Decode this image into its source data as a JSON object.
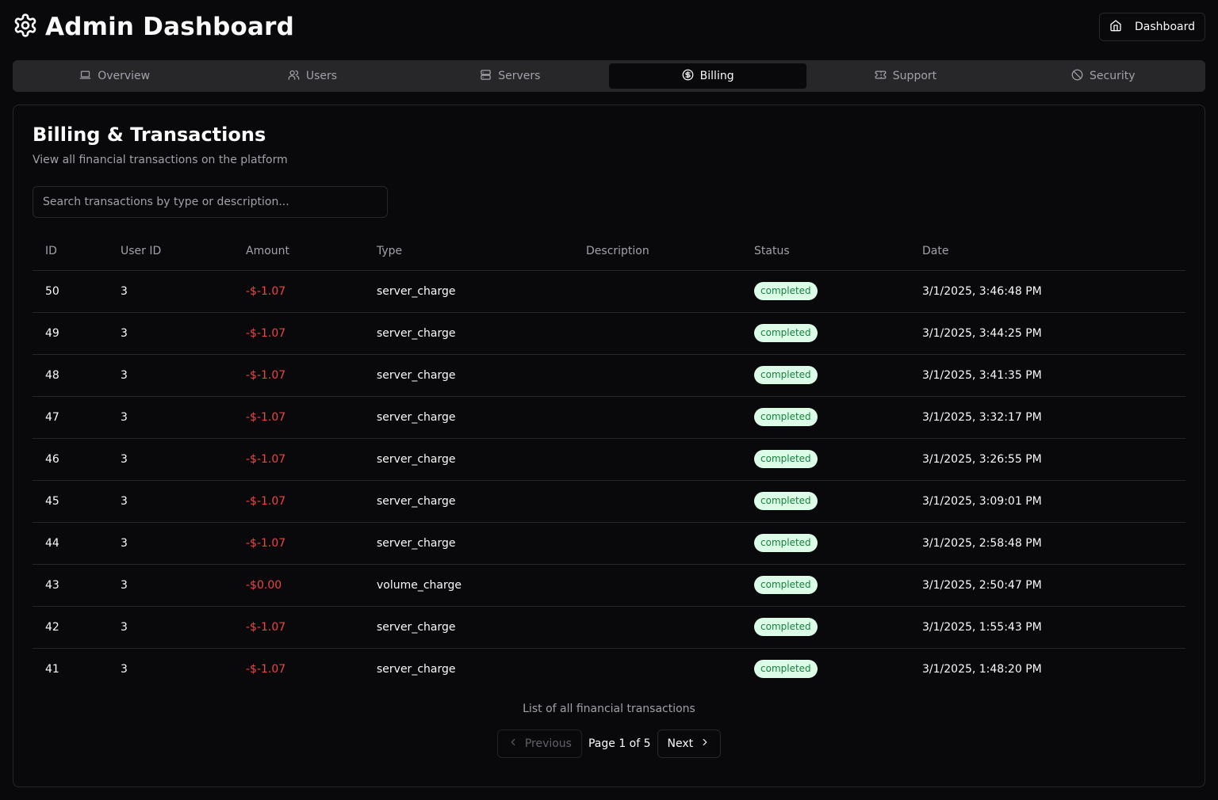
{
  "header": {
    "title": "Admin Dashboard",
    "dashboard_button": "Dashboard"
  },
  "tabs": [
    {
      "label": "Overview",
      "icon": "laptop-icon"
    },
    {
      "label": "Users",
      "icon": "users-icon"
    },
    {
      "label": "Servers",
      "icon": "server-icon"
    },
    {
      "label": "Billing",
      "icon": "dollar-circle-icon",
      "active": true
    },
    {
      "label": "Support",
      "icon": "ticket-icon"
    },
    {
      "label": "Security",
      "icon": "ban-icon"
    }
  ],
  "billing": {
    "title": "Billing & Transactions",
    "description": "View all financial transactions on the platform",
    "search_placeholder": "Search transactions by type or description...",
    "columns": [
      "ID",
      "User ID",
      "Amount",
      "Type",
      "Description",
      "Status",
      "Date"
    ],
    "rows": [
      {
        "id": "50",
        "user_id": "3",
        "amount": "-$-1.07",
        "type": "server_charge",
        "description": "",
        "status": "completed",
        "date": "3/1/2025, 3:46:48 PM"
      },
      {
        "id": "49",
        "user_id": "3",
        "amount": "-$-1.07",
        "type": "server_charge",
        "description": "",
        "status": "completed",
        "date": "3/1/2025, 3:44:25 PM"
      },
      {
        "id": "48",
        "user_id": "3",
        "amount": "-$-1.07",
        "type": "server_charge",
        "description": "",
        "status": "completed",
        "date": "3/1/2025, 3:41:35 PM"
      },
      {
        "id": "47",
        "user_id": "3",
        "amount": "-$-1.07",
        "type": "server_charge",
        "description": "",
        "status": "completed",
        "date": "3/1/2025, 3:32:17 PM"
      },
      {
        "id": "46",
        "user_id": "3",
        "amount": "-$-1.07",
        "type": "server_charge",
        "description": "",
        "status": "completed",
        "date": "3/1/2025, 3:26:55 PM"
      },
      {
        "id": "45",
        "user_id": "3",
        "amount": "-$-1.07",
        "type": "server_charge",
        "description": "",
        "status": "completed",
        "date": "3/1/2025, 3:09:01 PM"
      },
      {
        "id": "44",
        "user_id": "3",
        "amount": "-$-1.07",
        "type": "server_charge",
        "description": "",
        "status": "completed",
        "date": "3/1/2025, 2:58:48 PM"
      },
      {
        "id": "43",
        "user_id": "3",
        "amount": "-$0.00",
        "type": "volume_charge",
        "description": "",
        "status": "completed",
        "date": "3/1/2025, 2:50:47 PM"
      },
      {
        "id": "42",
        "user_id": "3",
        "amount": "-$-1.07",
        "type": "server_charge",
        "description": "",
        "status": "completed",
        "date": "3/1/2025, 1:55:43 PM"
      },
      {
        "id": "41",
        "user_id": "3",
        "amount": "-$-1.07",
        "type": "server_charge",
        "description": "",
        "status": "completed",
        "date": "3/1/2025, 1:48:20 PM"
      }
    ],
    "caption": "List of all financial transactions",
    "pagination": {
      "previous": "Previous",
      "page_info": "Page 1 of 5",
      "next": "Next"
    }
  },
  "colors": {
    "background": "#09090b",
    "border": "#27272a",
    "muted_text": "#a1a1aa",
    "negative_amount": "#ef4444",
    "badge_bg": "#dcfce7",
    "badge_text": "#15803d"
  }
}
